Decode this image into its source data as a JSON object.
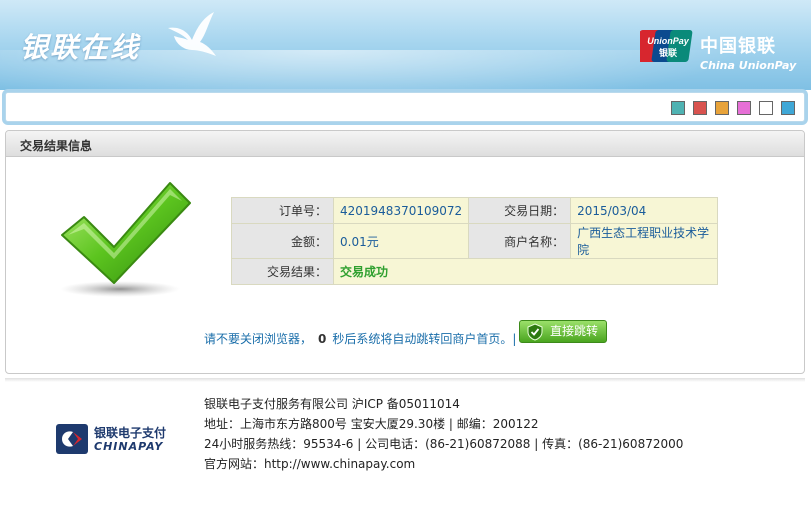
{
  "header": {
    "site_title": "银联在线",
    "brand_cn": "中国银联",
    "brand_en": "China UnionPay",
    "logo_text_1": "UnionPay",
    "logo_text_2": "银联"
  },
  "swatches": [
    {
      "name": "swatch-teal",
      "color": "#4fb3b3"
    },
    {
      "name": "swatch-red",
      "color": "#d9534f"
    },
    {
      "name": "swatch-orange",
      "color": "#e8a33a"
    },
    {
      "name": "swatch-pink",
      "color": "#e66fd6"
    },
    {
      "name": "swatch-white",
      "color": "#ffffff"
    },
    {
      "name": "swatch-blue",
      "color": "#3fa7d6"
    }
  ],
  "panel": {
    "title": "交易结果信息"
  },
  "result": {
    "order_label": "订单号：",
    "order_value": "4201948370109072",
    "date_label": "交易日期：",
    "date_value": "2015/03/04",
    "amount_label": "金额：",
    "amount_value": "0.01元",
    "merchant_label": "商户名称：",
    "merchant_value": "广西生态工程职业技术学院",
    "status_label": "交易结果：",
    "status_value": "交易成功"
  },
  "notice": {
    "text_before": "请不要关闭浏览器，",
    "countdown": "0",
    "text_after": "秒后系统将自动跳转回商户首页。|",
    "button_label": "直接跳转"
  },
  "footer": {
    "logo_cn": "银联电子支付",
    "logo_en": "CHINAPAY",
    "line1": "银联电子支付服务有限公司 沪ICP 备05011014",
    "line2": "地址：上海市东方路800号 宝安大厦29.30楼 | 邮编：200122",
    "line3": "24小时服务热线：95534-6 | 公司电话：(86-21)60872088 | 传真：(86-21)60872000",
    "line4": "官方网站：http://www.chinapay.com"
  }
}
